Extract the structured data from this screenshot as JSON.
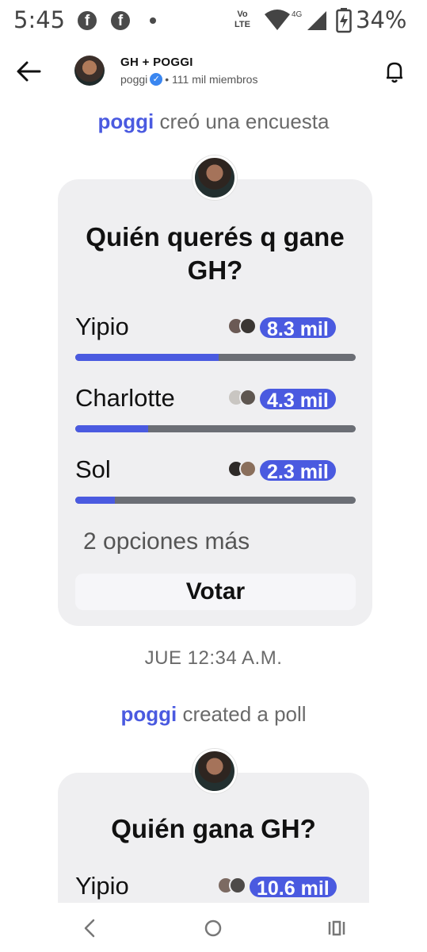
{
  "status_bar": {
    "time": "5:45",
    "notif_icon": "f",
    "volte_line1": "Vo",
    "volte_line2": "LTE",
    "network": "4G",
    "battery": "34%"
  },
  "header": {
    "title": "GH + POGGI",
    "author": "poggi",
    "members": "• 111 mil miembros"
  },
  "polls": [
    {
      "author": "poggi",
      "created_text": "creó una encuesta",
      "question": "Quién querés q gane GH?",
      "options": [
        {
          "label": "Yipio",
          "count": "8.3 mil",
          "fraction": 0.51
        },
        {
          "label": "Charlotte",
          "count": "4.3 mil",
          "fraction": 0.26
        },
        {
          "label": "Sol",
          "count": "2.3 mil",
          "fraction": 0.14
        }
      ],
      "more_options": "2 opciones más",
      "vote_label": "Votar"
    },
    {
      "author": "poggi",
      "created_text": "created a poll",
      "question": "Quién gana GH?",
      "options": [
        {
          "label": "Yipio",
          "count": "10.6 mil"
        }
      ]
    }
  ],
  "timestamp": "JUE 12:34 A.M.",
  "colors": {
    "accent": "#4a5ae0",
    "card_bg": "#efeff1",
    "bar_track": "#6b6e75",
    "verified": "#3a86f0"
  }
}
